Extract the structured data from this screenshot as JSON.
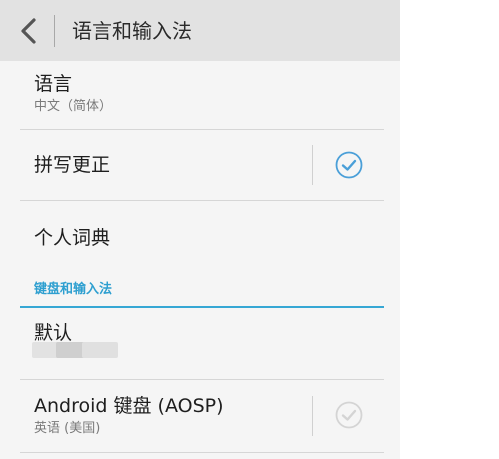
{
  "header": {
    "title": "语言和输入法",
    "back_icon": "chevron-left-icon"
  },
  "rows": {
    "language": {
      "title": "语言",
      "summary": "中文（简体）"
    },
    "spellcheck": {
      "title": "拼写更正",
      "checked": true
    },
    "dictionary": {
      "title": "个人词典"
    }
  },
  "section": {
    "keyboard_label": "键盘和输入法"
  },
  "keyboard": {
    "default": {
      "title": "默认"
    },
    "aosp": {
      "title": "Android 键盘 (AOSP)",
      "summary": "英语 (美国)",
      "checked": false
    }
  },
  "colors": {
    "accent": "#36a7d4",
    "check_active": "#4a9fd8",
    "check_inactive": "#d4d4d4"
  }
}
